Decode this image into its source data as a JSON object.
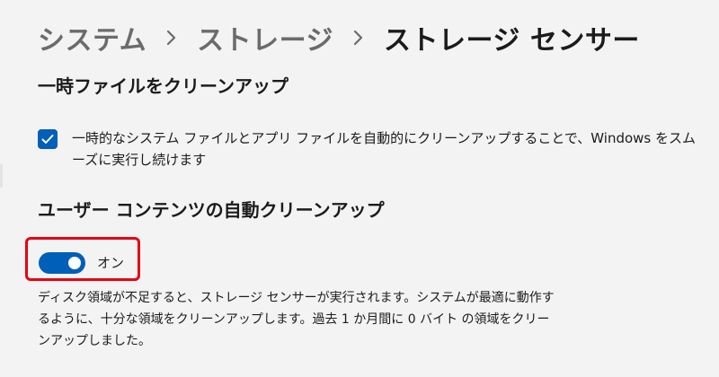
{
  "breadcrumb": {
    "items": [
      "システム",
      "ストレージ",
      "ストレージ センサー"
    ]
  },
  "sections": {
    "temp_files": {
      "title": "一時ファイルをクリーンアップ",
      "checkbox": {
        "checked": true,
        "label": "一時的なシステム ファイルとアプリ ファイルを自動的にクリーンアップすることで、Windows をスムーズに実行し続けます"
      }
    },
    "user_content": {
      "title": "ユーザー コンテンツの自動クリーンアップ",
      "toggle": {
        "on": true,
        "state_label": "オン"
      },
      "description": "ディスク領域が不足すると、ストレージ センサーが実行されます。システムが最適に動作するように、十分な領域をクリーンアップします。過去 1 か月間に 0 バイト の領域をクリーンアップしました。"
    }
  },
  "icons": {
    "breadcrumb_separator": "chevron-right-icon",
    "checkbox_mark": "checkmark-icon"
  },
  "colors": {
    "accent": "#005fb8",
    "highlight_border": "#e60012",
    "background": "#f3f3f3"
  }
}
